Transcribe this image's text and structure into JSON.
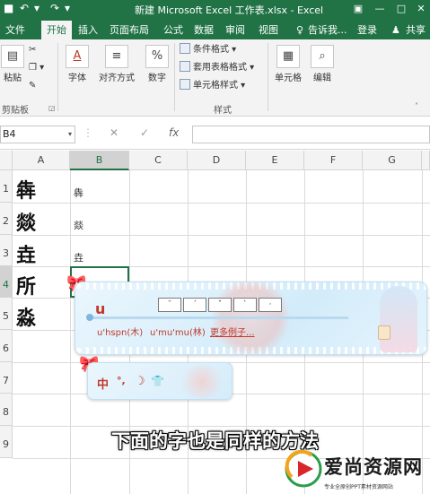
{
  "window": {
    "title": "新建 Microsoft Excel 工作表.xlsx - Excel",
    "controls": [
      "▣",
      "—",
      "□",
      "✕"
    ]
  },
  "tabs": {
    "items": [
      "文件",
      "开始",
      "插入",
      "页面布局",
      "公式",
      "数据",
      "审阅",
      "视图"
    ],
    "active": "开始",
    "tell_me": "告诉我...",
    "login": "登录",
    "share": "共享"
  },
  "ribbon": {
    "paste": "粘贴",
    "clipboard_group": "剪贴板",
    "font": "字体",
    "align": "对齐方式",
    "number": "数字",
    "conditional_format": "条件格式",
    "table_format": "套用表格格式",
    "cell_style": "单元格样式",
    "styles_group": "样式",
    "cells": "单元格",
    "edit": "编辑",
    "icons": {
      "font": "A",
      "number": "%"
    }
  },
  "formula_bar": {
    "name_box": "B4",
    "cancel": "✕",
    "enter": "✓",
    "fx": "fx"
  },
  "grid": {
    "columns": [
      "A",
      "B",
      "C",
      "D",
      "E",
      "F",
      "G"
    ],
    "selected_column": "B",
    "rows": [
      "1",
      "2",
      "3",
      "4",
      "5",
      "6",
      "7",
      "8",
      "9"
    ],
    "selected_row": "4",
    "col_a": [
      "犇",
      "燚",
      "垚",
      "所",
      "淼"
    ],
    "col_b": [
      "犇",
      "燚",
      "垚"
    ]
  },
  "ime": {
    "input": "u",
    "tones": [
      "¯",
      "ˊ",
      "ˇ",
      "ˋ",
      "·"
    ],
    "candidates": [
      "u'hspn(木)",
      "u'mu'mu(林)"
    ],
    "more": "更多例子...",
    "status": {
      "lang": "中",
      "punct": "°,",
      "moon": "☽",
      "shirt": "👕"
    },
    "accent": "#c0392b"
  },
  "subtitle": "下面的字也是同样的方法",
  "watermark": {
    "name": "爱尚资源网",
    "tagline": "专业全原创PPT素材资源网站"
  }
}
